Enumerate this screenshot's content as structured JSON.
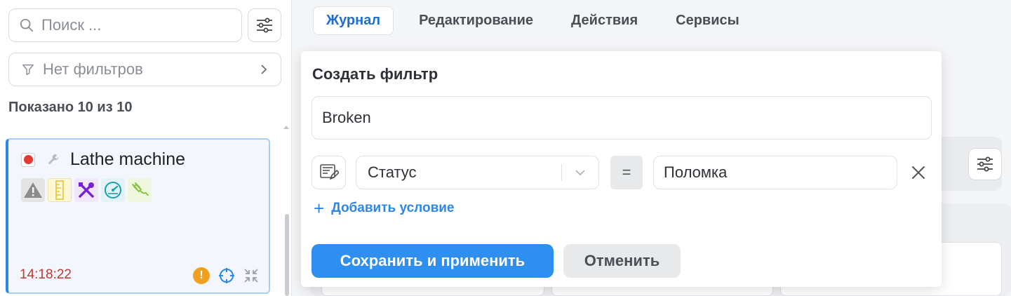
{
  "sidebar": {
    "search": {
      "placeholder": "Поиск ...",
      "value": ""
    },
    "filters_label": "Нет фильтров",
    "shown_count": "Показано 10 из 10",
    "device": {
      "name": "Lathe machine",
      "status_color": "#e53935",
      "time": "14:18:22",
      "badges": [
        "warning-icon",
        "ruler-icon",
        "tools-icon",
        "gauge-icon",
        "plug-icon"
      ]
    }
  },
  "tabs": [
    {
      "label": "Журнал",
      "active": true
    },
    {
      "label": "Редактирование",
      "active": false
    },
    {
      "label": "Действия",
      "active": false
    },
    {
      "label": "Сервисы",
      "active": false
    }
  ],
  "filter_popup": {
    "title": "Создать фильтр",
    "name_value": "Broken",
    "condition": {
      "field": "Статус",
      "operator": "=",
      "value": "Поломка"
    },
    "add_condition_label": "Добавить условие",
    "save_label": "Сохранить и применить",
    "cancel_label": "Отменить"
  },
  "colors": {
    "accent": "#2e8ff0",
    "tab_active": "#1e6fd0",
    "time_text": "#c0392b"
  }
}
